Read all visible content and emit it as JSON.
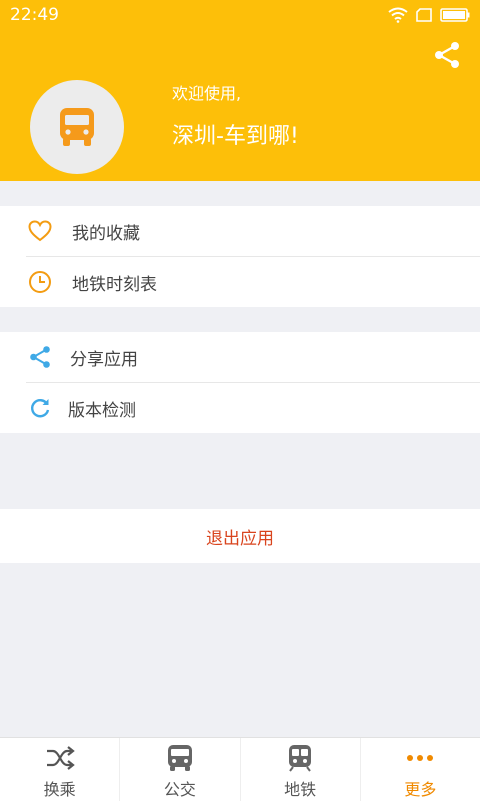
{
  "status_bar": {
    "time": "22:49"
  },
  "header": {
    "welcome": "欢迎使用,",
    "app_name": "深圳-车到哪!",
    "color": "#fdbf09"
  },
  "menu_group_1": [
    {
      "label": "我的收藏",
      "icon": "heart-icon"
    },
    {
      "label": "地铁时刻表",
      "icon": "clock-icon"
    }
  ],
  "menu_group_2": [
    {
      "label": "分享应用",
      "icon": "share-icon"
    },
    {
      "label": "版本检测",
      "icon": "refresh-icon"
    }
  ],
  "logout_label": "退出应用",
  "tabs": [
    {
      "label": "换乘",
      "icon": "shuffle-icon",
      "active": false
    },
    {
      "label": "公交",
      "icon": "bus-icon",
      "active": false
    },
    {
      "label": "地铁",
      "icon": "metro-icon",
      "active": false
    },
    {
      "label": "更多",
      "icon": "more-icon",
      "active": true
    }
  ]
}
